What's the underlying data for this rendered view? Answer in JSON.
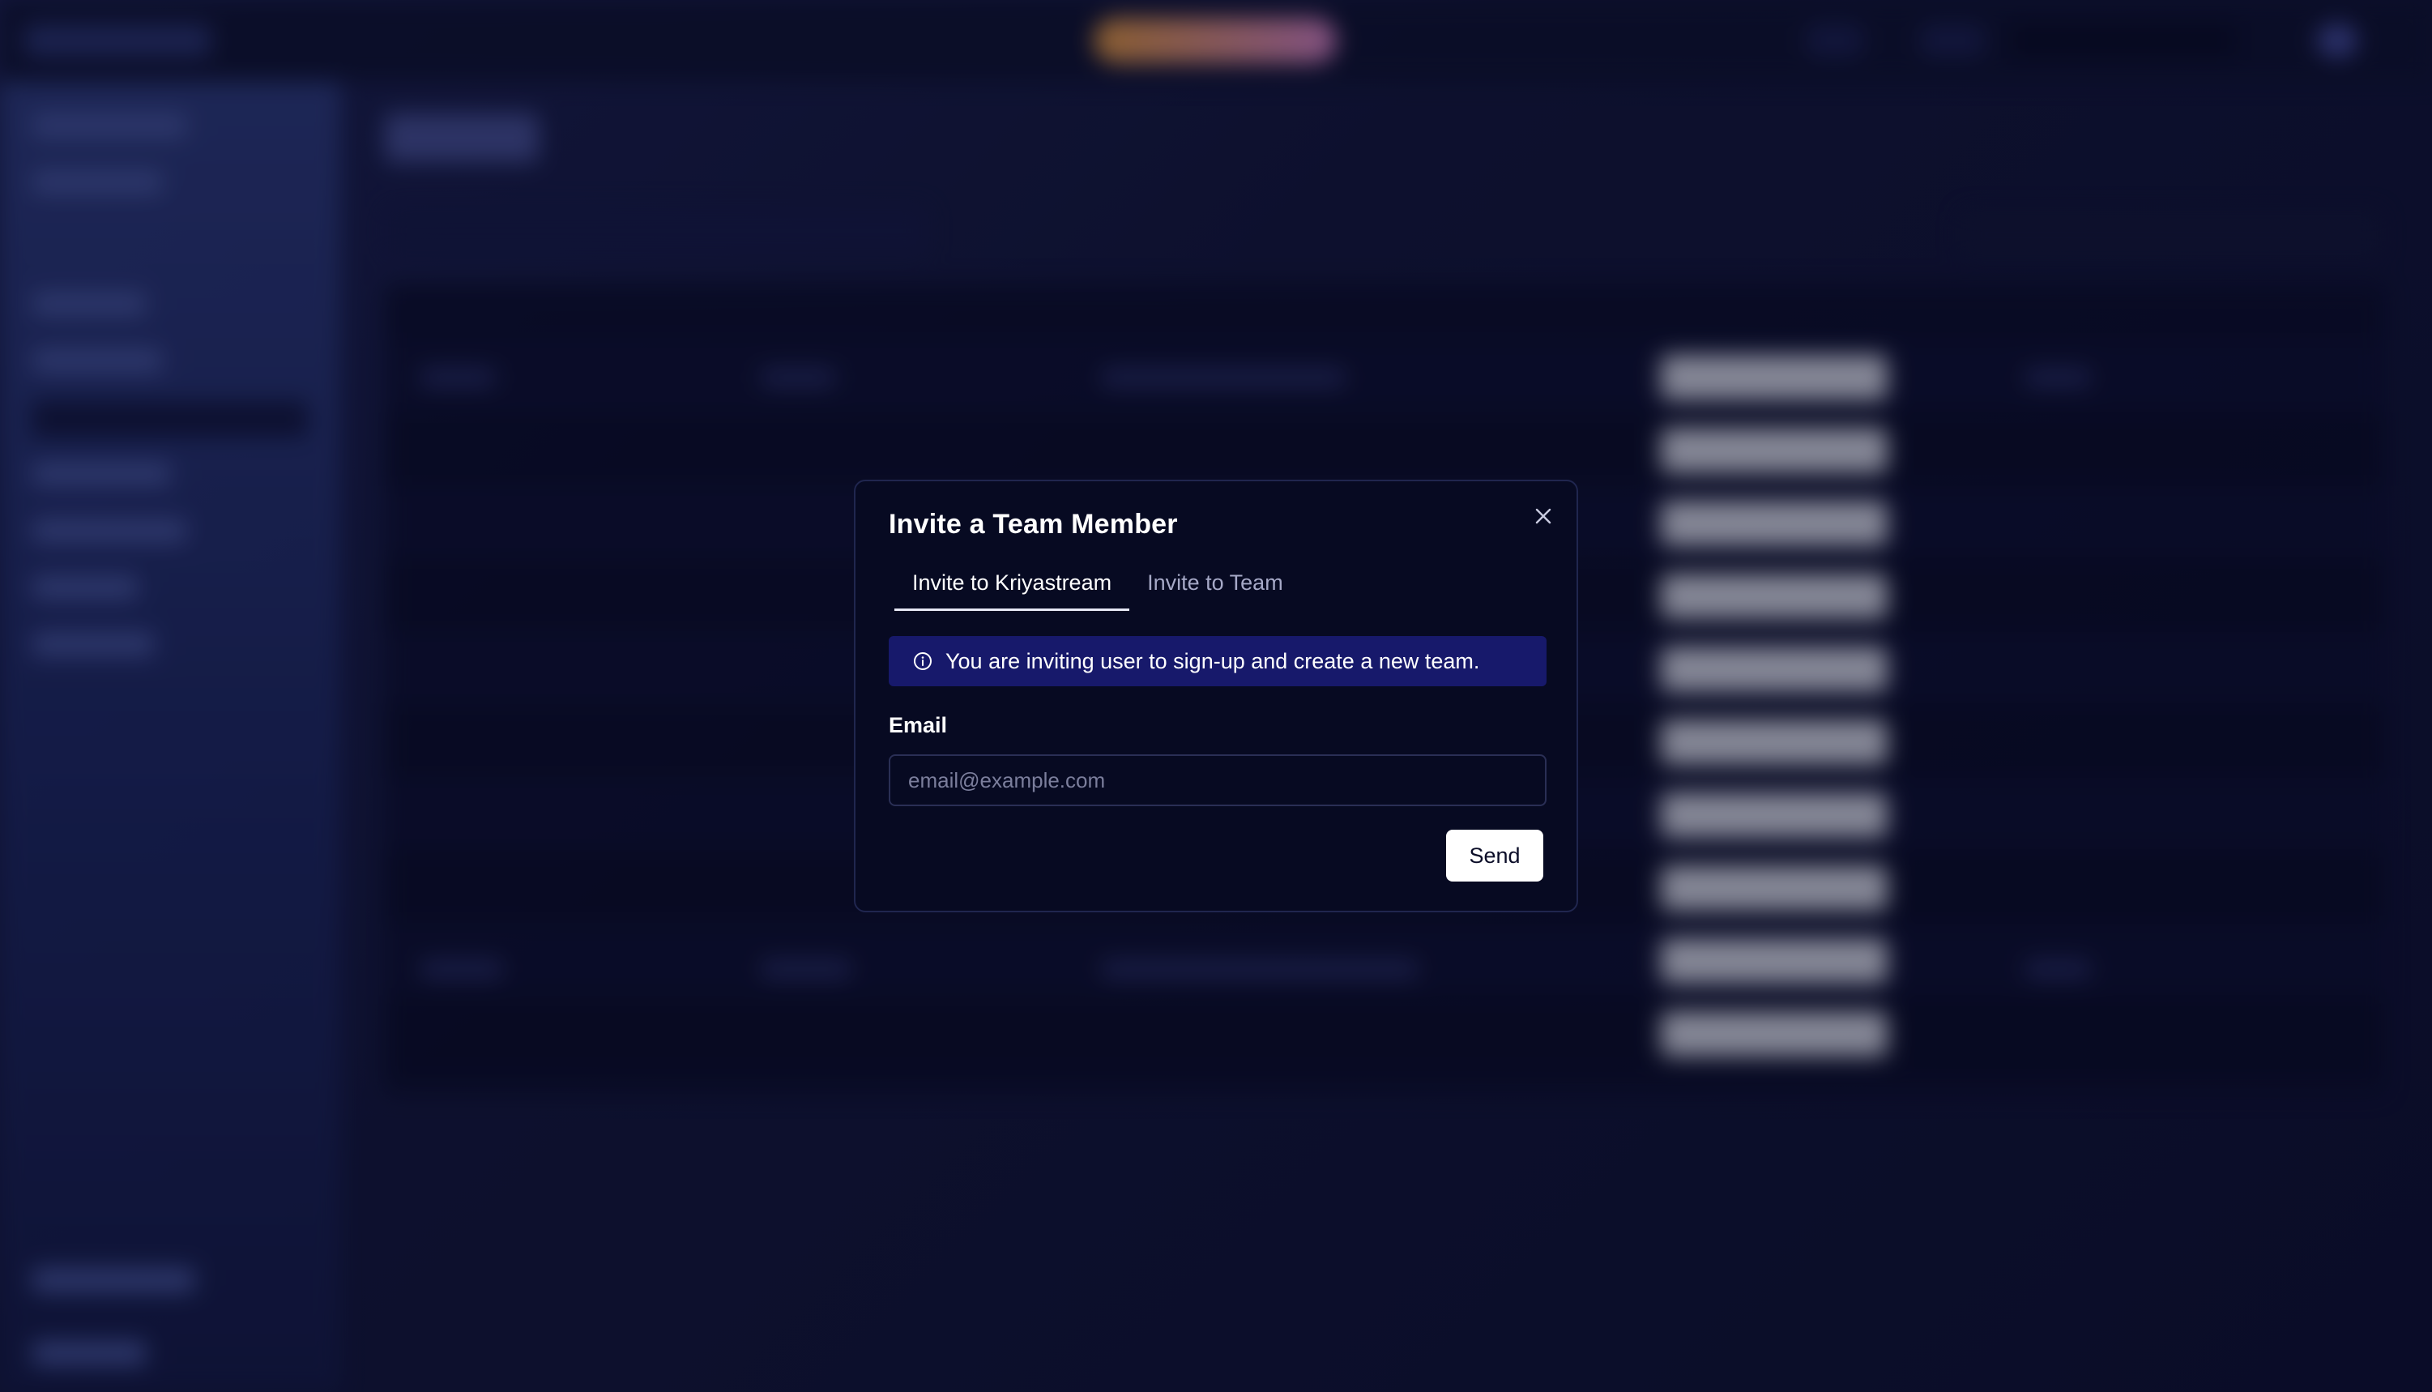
{
  "modal": {
    "title": "Invite a Team Member",
    "tabs": [
      {
        "label": "Invite to Kriyastream",
        "active": true
      },
      {
        "label": "Invite to Team",
        "active": false
      }
    ],
    "info_text": "You are inviting user to sign-up and create a new team.",
    "email_label": "Email",
    "email_placeholder": "email@example.com",
    "email_value": "",
    "send_label": "Send"
  },
  "colors": {
    "modal_bg": "#070a22",
    "banner_bg": "#17196b",
    "accent_promo_start": "#f4a23a",
    "accent_promo_end": "#e58ad0"
  },
  "icons": {
    "close": "close-icon",
    "info": "info-icon"
  }
}
